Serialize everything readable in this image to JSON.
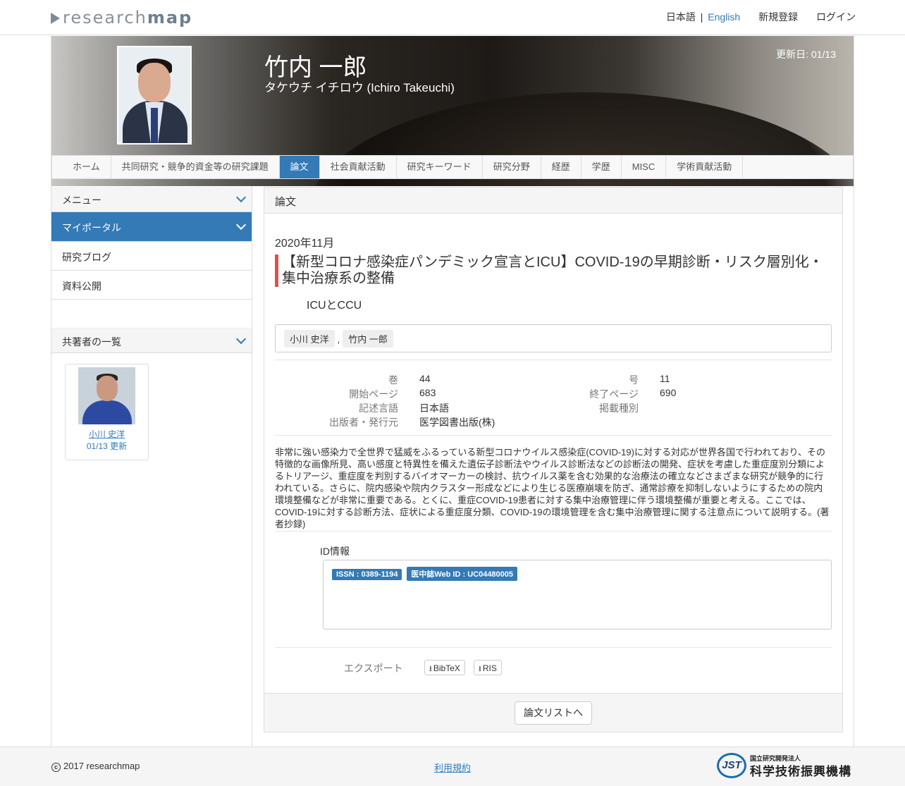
{
  "header": {
    "logo_light": "research",
    "logo_bold": "map",
    "lang_ja": "日本語",
    "lang_sep": "|",
    "lang_en": "English",
    "register": "新規登録",
    "login": "ログイン"
  },
  "profile": {
    "name": "竹内 一郎",
    "kana": "タケウチ イチロウ  (Ichiro Takeuchi)",
    "updated": "更新日: 01/13"
  },
  "tabs": [
    "ホーム",
    "共同研究・競争的資金等の研究課題",
    "論文",
    "社会貢献活動",
    "研究キーワード",
    "研究分野",
    "経歴",
    "学歴",
    "MISC",
    "学術貢献活動"
  ],
  "active_tab": "論文",
  "sidebar": {
    "menu": "メニュー",
    "items": [
      "マイポータル",
      "研究ブログ",
      "資料公開"
    ],
    "coauthors_title": "共著者の一覧",
    "coauthor": {
      "name": "小川 史洋",
      "updated": "01/13 更新"
    }
  },
  "paper": {
    "section": "論文",
    "date": "2020年11月",
    "title": "【新型コロナ感染症パンデミック宣言とICU】COVID-19の早期診断・リスク層別化・集中治療系の整備",
    "journal": "ICUとCCU",
    "authors": [
      "小川 史洋",
      "竹内 一郎"
    ],
    "author_sep": ",",
    "meta": {
      "volume_label": "巻",
      "volume": "44",
      "issue_label": "号",
      "issue": "11",
      "start_label": "開始ページ",
      "start": "683",
      "end_label": "終了ページ",
      "end": "690",
      "lang_label": "記述言語",
      "lang": "日本語",
      "type_label": "掲載種別",
      "type": "",
      "publisher_label": "出版者・発行元",
      "publisher": "医学図書出版(株)"
    },
    "abstract": "非常に強い感染力で全世界で猛威をふるっている新型コロナウイルス感染症(COVID-19)に対する対応が世界各国で行われており、その特徴的な画像所見、高い感度と特異性を備えた遺伝子診断法やウイルス診断法などの診断法の開発、症状を考慮した重症度別分類によるトリアージ、重症度を判別するバイオマーカーの検討、抗ウイルス薬を含む効果的な治療法の確立などさまざまな研究が競争的に行われている。さらに、院内感染や院内クラスター形成などにより生じる医療崩壊を防ぎ、通常診療を抑制しないようにするための院内環境整備などが非常に重要である。とくに、重症COVID-19患者に対する集中治療管理に伴う環境整備が重要と考える。ここでは、COVID-19に対する診断方法、症状による重症度分類、COVID-19の環境管理を含む集中治療管理に関する注意点について説明する。(著者抄録)",
    "id_label": "ID情報",
    "ids": [
      "ISSN : 0389-1194",
      "医中誌Web ID : UC04480005"
    ],
    "export_label": "エクスポート",
    "export_bibtex": "BibTeX",
    "export_ris": "RIS",
    "back_button": "論文リストへ"
  },
  "footer": {
    "copyright": "2017 researchmap",
    "terms": "利用規約",
    "jst_small": "国立研究開発法人",
    "jst_big": "科学技術振興機構",
    "jst_mark": "JST"
  }
}
